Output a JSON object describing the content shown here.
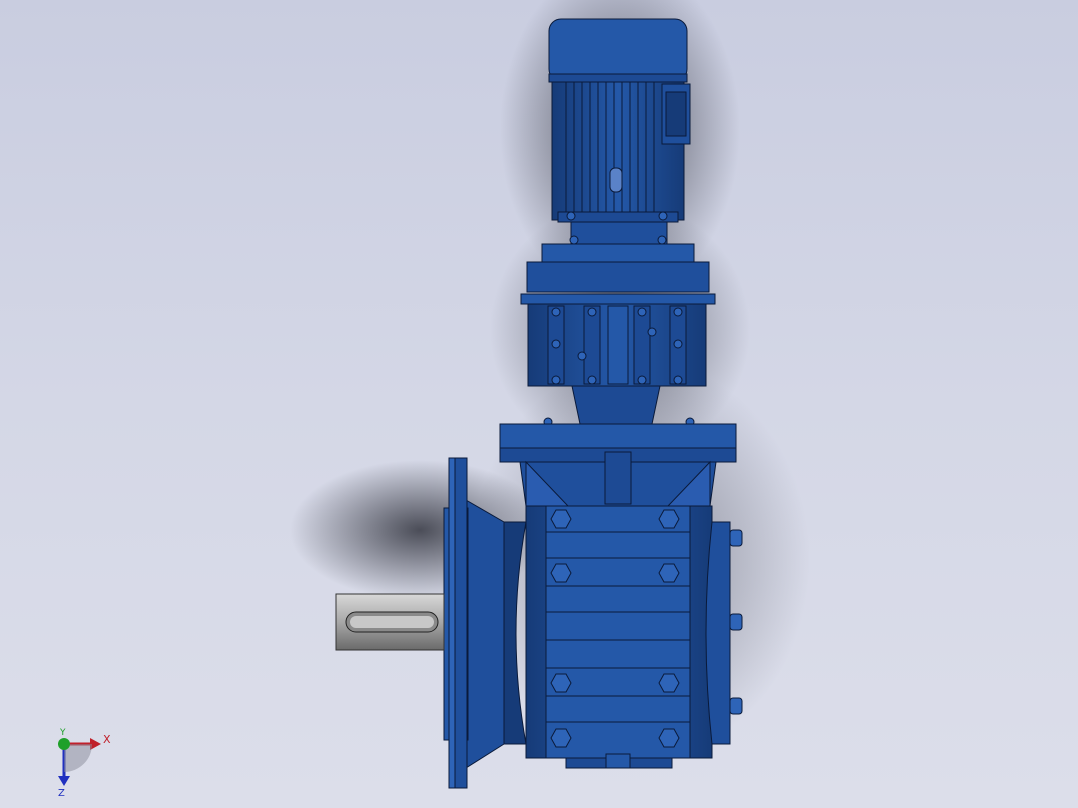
{
  "viewport": {
    "background_top": "#c9cde0",
    "background_bottom": "#dcdeea"
  },
  "model": {
    "body_color": "#1f4f9c",
    "body_dark": "#163b78",
    "body_light": "#2e64b8",
    "edge_color": "#0a1a3a",
    "shaft_color": "#9a9a9a"
  },
  "triad": {
    "x_label": "X",
    "y_label": "Y",
    "z_label": "Z",
    "x_color": "#c0202a",
    "y_color": "#1fa02a",
    "z_color": "#2030c0"
  }
}
